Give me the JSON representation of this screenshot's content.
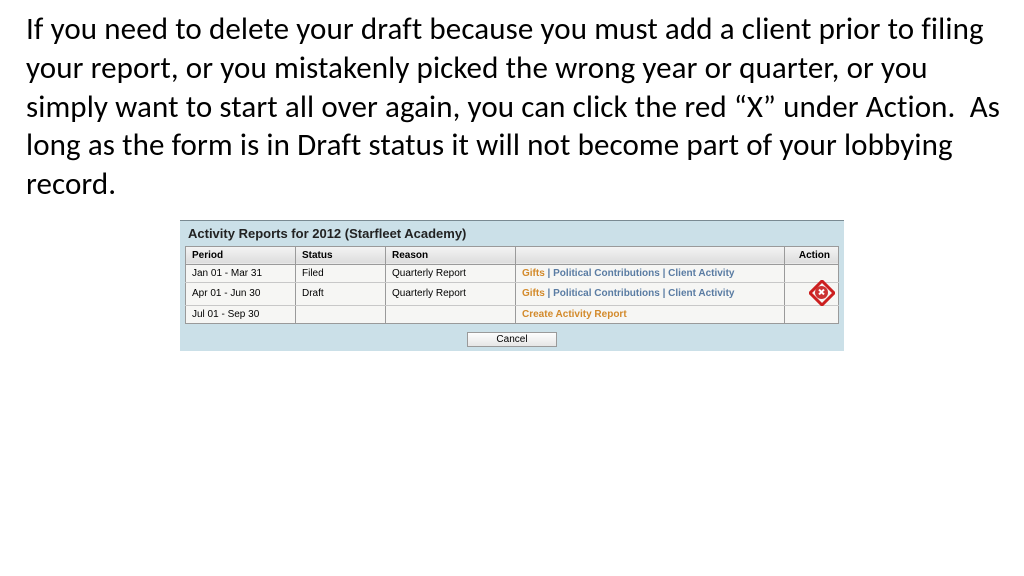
{
  "instruction_text": "If you need to delete your draft because you must add a client prior to filing your report, or you mistakenly picked the wrong year or quarter, or you simply want to start all over again, you can click the red “X” under Action.  As long as the form is in Draft status it will not become part of your lobbying record.",
  "panel": {
    "title": "Activity Reports for 2012 (Starfleet Academy)",
    "headers": {
      "period": "Period",
      "status": "Status",
      "reason": "Reason",
      "action": "Action"
    },
    "rows": [
      {
        "period": "Jan 01 - Mar 31",
        "status": "Filed",
        "reason": "Quarterly Report",
        "links": {
          "gifts": "Gifts",
          "political": "Political Contributions",
          "client": "Client Activity"
        },
        "deletable": false
      },
      {
        "period": "Apr 01 - Jun 30",
        "status": "Draft",
        "reason": "Quarterly Report",
        "links": {
          "gifts": "Gifts",
          "political": "Political Contributions",
          "client": "Client Activity"
        },
        "deletable": true
      },
      {
        "period": "Jul 01 - Sep 30",
        "status": "",
        "reason": "",
        "create_link": "Create Activity Report",
        "deletable": false
      }
    ],
    "separator": " | ",
    "cancel_label": "Cancel"
  }
}
